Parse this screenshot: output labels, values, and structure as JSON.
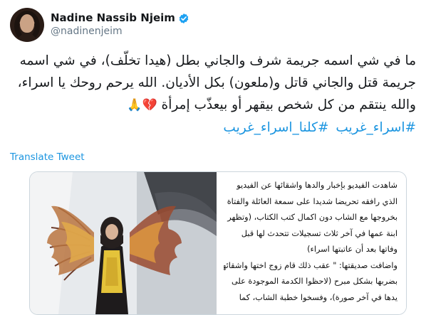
{
  "header": {
    "display_name": "Nadine Nassib Njeim",
    "handle": "@nadinenjeim",
    "verified_icon": "verified-badge-icon"
  },
  "tweet": {
    "lines": [
      "ما في شي اسمه جريمة شرف والجاني بطل (هيدا تخلّف)، في شي اسمه",
      "جريمة قتل والجاني قاتل و(ملعون) بكل الأديان. الله يرحم روحك يا اسراء،",
      "والله ينتقم من كل شخص بيقهر أو بيعذّب إمرأة"
    ],
    "emojis": "💔🙏",
    "hashtags": [
      "#اسراء_غريب",
      "#كلنا_اسراء_غريب"
    ]
  },
  "translate_label": "Translate Tweet",
  "media": {
    "image_name": "veiled-woman-with-wings-illustration",
    "article_lines": [
      "شاهدت الفيديو بإخبار والدها واشقائها عن الفيديو",
      "الذي رافقه تحريضا شديدا على سمعة العائلة والفتاة",
      "بخروجها مع الشاب دون اكمال كتب الكتاب، (وتظهر",
      "ابنة عمها في آخر ثلاث تسجيلات تتحدث لها قبل",
      "وفاتها بعد أن عاتبتها اسراء)",
      "واضافت صديقتها: \" عقب ذلك قام زوج اختها واشقائها",
      "بضربها بشكل مبرح (لاحظوا الكدمة الموجودة على",
      "يدها في آخر صورة)، وفسخوا خطبة الشاب، كما"
    ]
  },
  "colors": {
    "link": "#1b95e0",
    "text": "#14171a",
    "muted": "#657786",
    "verified": "#1da1f2",
    "border": "#ccd6dd"
  }
}
